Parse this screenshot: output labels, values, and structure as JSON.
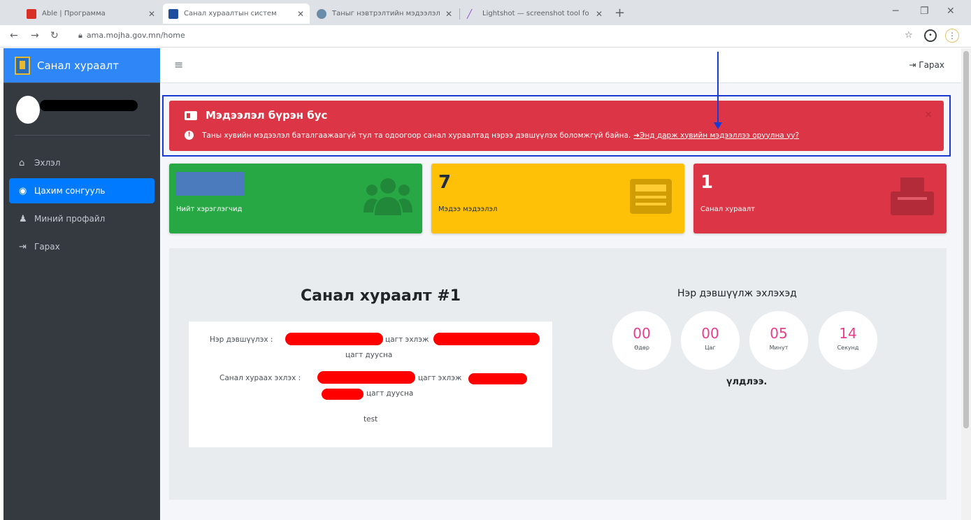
{
  "browser": {
    "tabs": [
      {
        "title": "Able | Программа",
        "active": false
      },
      {
        "title": "Санал хураалтын систем",
        "active": true
      },
      {
        "title": "Таныг нэвтрэлтийн мэдээлэл",
        "active": false
      },
      {
        "title": "Lightshot — screenshot tool fo",
        "active": false
      }
    ],
    "url": "ama.mojha.gov.mn/home"
  },
  "sidebar": {
    "brand": "Санал хураалт",
    "items": [
      {
        "label": "Эхлэл",
        "icon": "home-icon",
        "active": false
      },
      {
        "label": "Цахим сонгууль",
        "icon": "gauge-icon",
        "active": true
      },
      {
        "label": "Миний профайл",
        "icon": "user-icon",
        "active": false
      },
      {
        "label": "Гарах",
        "icon": "sign-out-icon",
        "active": false
      }
    ]
  },
  "topbar": {
    "logout_label": "Гарах"
  },
  "alert": {
    "title": "Мэдээлэл бүрэн бус",
    "message": "Таны хувийн мэдээлэл баталгаажаагүй тул та одоогоор санал хураалтад нэрээ дэвшүүлэх боломжгүй байна.",
    "link_label": "Энд дарж хувийн мэдээллээ оруулна уу?"
  },
  "stats": [
    {
      "value": "",
      "label": "Нийт хэрэглэгчид",
      "color": "#28a745"
    },
    {
      "value": "7",
      "label": "Мэдээ мэдээлэл",
      "color": "#ffc107"
    },
    {
      "value": "1",
      "label": "Санал хураалт",
      "color": "#dc3545"
    }
  ],
  "poll": {
    "title": "Санал хураалт #1",
    "nomination_prefix": "Нэр дэвшүүлэх :",
    "starts_at": "цагт эхлэж",
    "ends_at": "цагт дуусна",
    "voting_prefix": "Санал хураах эхлэх :",
    "description": "test"
  },
  "countdown": {
    "title": "Нэр дэвшүүлж эхлэхэд",
    "units": [
      {
        "value": "00",
        "label": "Өдөр"
      },
      {
        "value": "00",
        "label": "Цаг"
      },
      {
        "value": "05",
        "label": "Минут"
      },
      {
        "value": "14",
        "label": "Секунд"
      }
    ],
    "suffix": "үлдлээ."
  }
}
